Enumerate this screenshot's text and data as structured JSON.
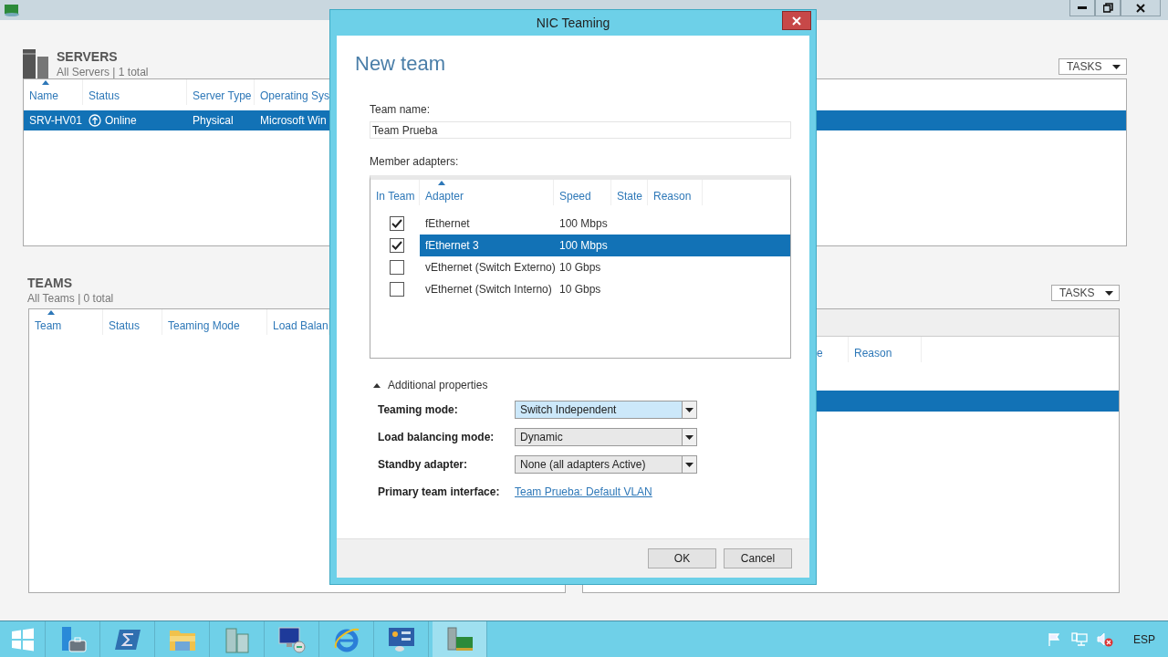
{
  "servers": {
    "title": "SERVERS",
    "subtitle": "All Servers | 1 total",
    "tasks": "TASKS",
    "columns": [
      {
        "label": "Name",
        "sorted": true
      },
      {
        "label": "Status",
        "sorted": false
      },
      {
        "label": "Server Type",
        "sorted": false
      },
      {
        "label": "Operating Sys",
        "sorted": false
      }
    ],
    "rows": [
      {
        "name": "SRV-HV01",
        "status": "Online",
        "type": "Physical",
        "os": "Microsoft Win",
        "selected": true
      }
    ]
  },
  "teams": {
    "title": "TEAMS",
    "subtitle": "All Teams | 0 total",
    "columns": [
      {
        "label": "Team",
        "sorted": true
      },
      {
        "label": "Status",
        "sorted": false
      },
      {
        "label": "Teaming Mode",
        "sorted": false
      },
      {
        "label": "Load Balan",
        "sorted": false
      }
    ]
  },
  "adapters_panel": {
    "tasks": "TASKS",
    "columns": [
      "e",
      "Reason"
    ],
    "rows": [
      {
        "selected": false
      },
      {
        "selected": true
      }
    ]
  },
  "dialog": {
    "title": "NIC Teaming",
    "heading": "New team",
    "team_name": {
      "label": "Team name:",
      "value": "Team Prueba"
    },
    "member_adapters": {
      "label": "Member adapters:",
      "columns": [
        {
          "label": "In Team",
          "sorted": false
        },
        {
          "label": "Adapter",
          "sorted": true
        },
        {
          "label": "Speed",
          "sorted": false
        },
        {
          "label": "State",
          "sorted": false
        },
        {
          "label": "Reason",
          "sorted": false
        }
      ],
      "rows": [
        {
          "in_team": true,
          "adapter": "fEthernet",
          "speed": "100 Mbps",
          "selected": false
        },
        {
          "in_team": true,
          "adapter": "fEthernet 3",
          "speed": "100 Mbps",
          "selected": true
        },
        {
          "in_team": false,
          "adapter": "vEthernet (Switch Externo)",
          "speed": "10 Gbps",
          "selected": false
        },
        {
          "in_team": false,
          "adapter": "vEthernet (Switch Interno)",
          "speed": "10 Gbps",
          "selected": false
        }
      ]
    },
    "additional_properties": {
      "label": "Additional properties",
      "expanded": true,
      "fields": [
        {
          "kind": "dropdown",
          "label": "Teaming mode:",
          "value": "Switch Independent",
          "focused": true
        },
        {
          "kind": "dropdown",
          "label": "Load balancing mode:",
          "value": "Dynamic",
          "focused": false
        },
        {
          "kind": "dropdown",
          "label": "Standby adapter:",
          "value": "None (all adapters Active)",
          "focused": false
        },
        {
          "kind": "link",
          "label": "Primary team interface:",
          "value": "Team Prueba: Default VLAN"
        }
      ]
    },
    "buttons": [
      "OK",
      "Cancel"
    ]
  },
  "taskbar": {
    "apps": [
      {
        "kind": "start",
        "selected": false
      },
      {
        "kind": "manager",
        "selected": false
      },
      {
        "kind": "powershell",
        "selected": false
      },
      {
        "kind": "explorer",
        "selected": false
      },
      {
        "kind": "servers",
        "selected": false
      },
      {
        "kind": "remote",
        "selected": false
      },
      {
        "kind": "browser",
        "selected": false
      },
      {
        "kind": "panel",
        "selected": false
      },
      {
        "kind": "nic",
        "selected": true
      }
    ],
    "language": "ESP"
  }
}
